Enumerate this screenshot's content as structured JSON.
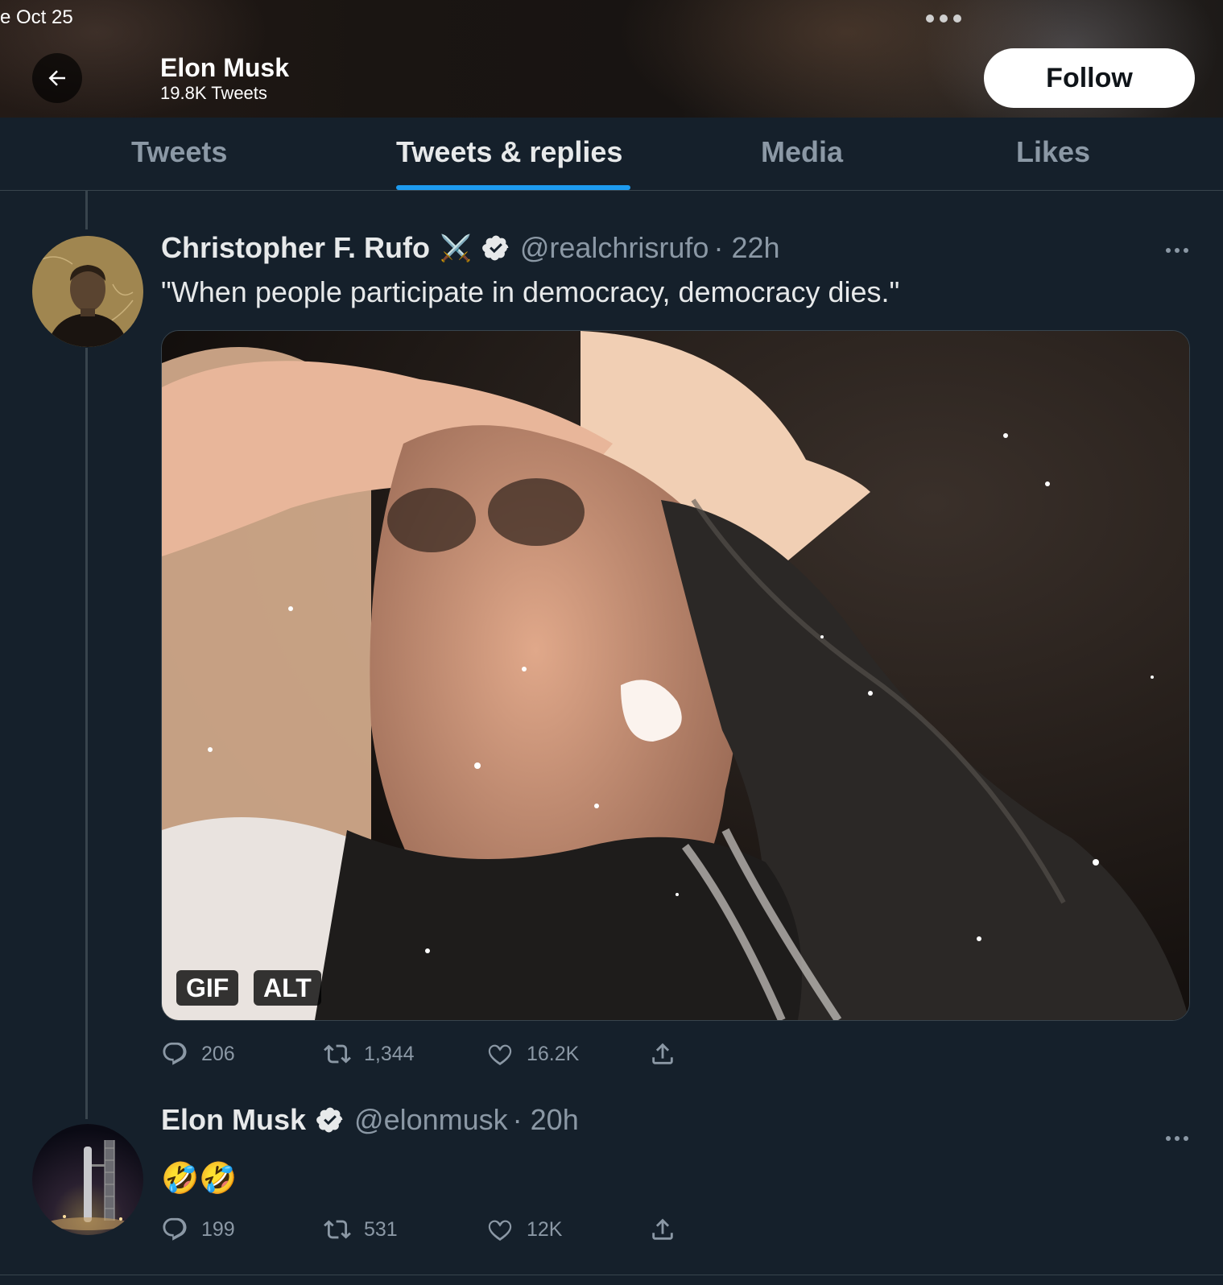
{
  "status_bar": {
    "date": "e Oct 25"
  },
  "header": {
    "name": "Elon Musk",
    "tweet_count": "19.8K Tweets",
    "follow_label": "Follow"
  },
  "tabs": [
    {
      "label": "Tweets",
      "active": false
    },
    {
      "label": "Tweets & replies",
      "active": true
    },
    {
      "label": "Media",
      "active": false
    },
    {
      "label": "Likes",
      "active": false
    }
  ],
  "tweets": [
    {
      "name": "Christopher F. Rufo",
      "name_emoji": "⚔️",
      "verified": true,
      "handle": "@realchrisrufo",
      "time": "· 22h",
      "text": "\"When people participate in democracy, democracy dies.\"",
      "media": {
        "badges": [
          "GIF",
          "ALT"
        ]
      },
      "replies": "206",
      "retweets": "1,344",
      "likes": "16.2K"
    },
    {
      "name": "Elon Musk",
      "verified": true,
      "handle": "@elonmusk",
      "time": "· 20h",
      "text": "🤣🤣",
      "replies": "199",
      "retweets": "531",
      "likes": "12K"
    }
  ],
  "colors": {
    "background": "#15202b",
    "accent": "#1d9bf0",
    "secondary_text": "#8b98a5",
    "divider": "#38444d"
  }
}
